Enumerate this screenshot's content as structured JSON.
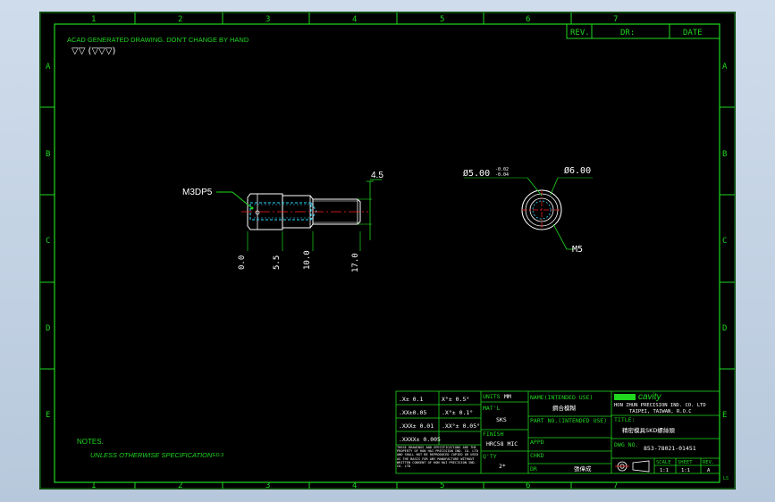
{
  "header_note": "ACAD GENERATED DRAWING. DON'T CHANGE BY HAND",
  "surface_symbol": "▽▽ (▽▽▽)",
  "rev_block": {
    "rev": "REV.",
    "dr": "DR:",
    "date": "DATE"
  },
  "col_labels": [
    "1",
    "2",
    "3",
    "4",
    "5",
    "6",
    "7"
  ],
  "row_labels": [
    "A",
    "B",
    "C",
    "D",
    "E"
  ],
  "dims": {
    "thread_callout": "M3DP5",
    "length_top": "4.5",
    "x_ords": [
      "0.0",
      "5.5",
      "10.0",
      "17.0"
    ],
    "dia_small": "Ø5.00",
    "dia_small_tol_upper": "-0.02",
    "dia_small_tol_lower": "-0.04",
    "dia_large": "Ø6.00",
    "thread_end": "M5"
  },
  "tolerances": {
    "left": [
      ".X± 0.1",
      ".XX±0.05",
      ".XXX± 0.01",
      ".XXXX± 0.005"
    ],
    "right": [
      "X°± 0.5°",
      ".X°± 0.1°",
      ".XX°± 0.05°"
    ],
    "disclaimer": "THESE DRAWINGS AND SPECIFICATIONS ARE THE PROPERTY OF HON HAI PRECISION IND. CO. LTD AND SHALL NOT BE REPRODUCED COPIED OR USED AS THE BASIS FOR ANY MANUFACTURE WITHOUT WRITTEN CONSENT OF HON HAI PRECISION IND. CO. LTD"
  },
  "title_block": {
    "units_label": "UNITS",
    "units_value": "MM",
    "matl_label": "MAT'L",
    "matl_value": "SKS",
    "finish_label": "FINISH",
    "finish_value": "HRC58 MIC",
    "qty_label": "Q'TY",
    "qty_value": "2*",
    "name_label": "NAME(INTENDED USE)",
    "name_value": "鋼合模糊",
    "partno_label": "PART NO.(INTENDED USE)",
    "appd_label": "APPD",
    "chkd_label": "CHKD",
    "dr_label": "DR",
    "dr_value": "張偉成",
    "company_logo": "cavity",
    "company_line1": "HON ZHUN PRECISION IND. CO. LTD",
    "company_line2": "TAIPEI, TAIWAN, R.O.C",
    "title_label": "TITLE:",
    "title_value": "精密模具SKD螺絲頭",
    "dwg_label": "DWG NO.",
    "dwg_value": "853-78021-01451",
    "scale_label": "SCALE",
    "sheet_label": "SHEET",
    "rev_label": "REV.",
    "scale_value": "1:1",
    "sheet_value": "1:1",
    "rev_value": "A"
  },
  "notes_title": "NOTES.",
  "notes_line": "UNLESS OTHERWISE SPECIFICATION",
  "notes_suffix": "ED.3",
  "corner_mark": "LS"
}
